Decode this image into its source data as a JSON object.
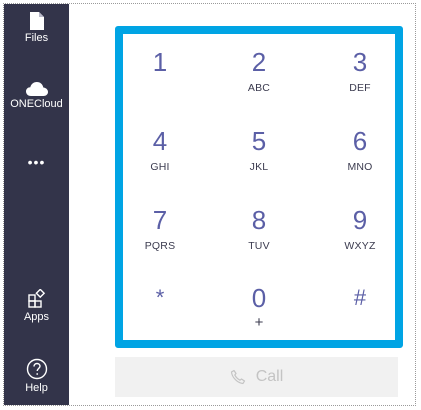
{
  "sidebar": {
    "items": [
      {
        "label": "Files",
        "icon": "files-icon"
      },
      {
        "label": "ONECloud",
        "icon": "cloud-icon"
      },
      {
        "label": "•••",
        "icon": "more-icon"
      },
      {
        "label": "Apps",
        "icon": "apps-icon"
      },
      {
        "label": "Help",
        "icon": "help-icon"
      }
    ]
  },
  "keypad": {
    "keys": [
      {
        "digit": "1",
        "letters": ""
      },
      {
        "digit": "2",
        "letters": "ABC"
      },
      {
        "digit": "3",
        "letters": "DEF"
      },
      {
        "digit": "4",
        "letters": "GHI"
      },
      {
        "digit": "5",
        "letters": "JKL"
      },
      {
        "digit": "6",
        "letters": "MNO"
      },
      {
        "digit": "7",
        "letters": "PQRS"
      },
      {
        "digit": "8",
        "letters": "TUV"
      },
      {
        "digit": "9",
        "letters": "WXYZ"
      },
      {
        "digit": "*",
        "letters": ""
      },
      {
        "digit": "0",
        "letters": "+"
      },
      {
        "digit": "#",
        "letters": ""
      }
    ]
  },
  "call_button": {
    "label": "Call",
    "icon": "phone-icon"
  },
  "colors": {
    "sidebar_bg": "#33344a",
    "keypad_border": "#00a4e4",
    "digit_color": "#5b5fa6",
    "call_bg": "#f1f1f1"
  }
}
